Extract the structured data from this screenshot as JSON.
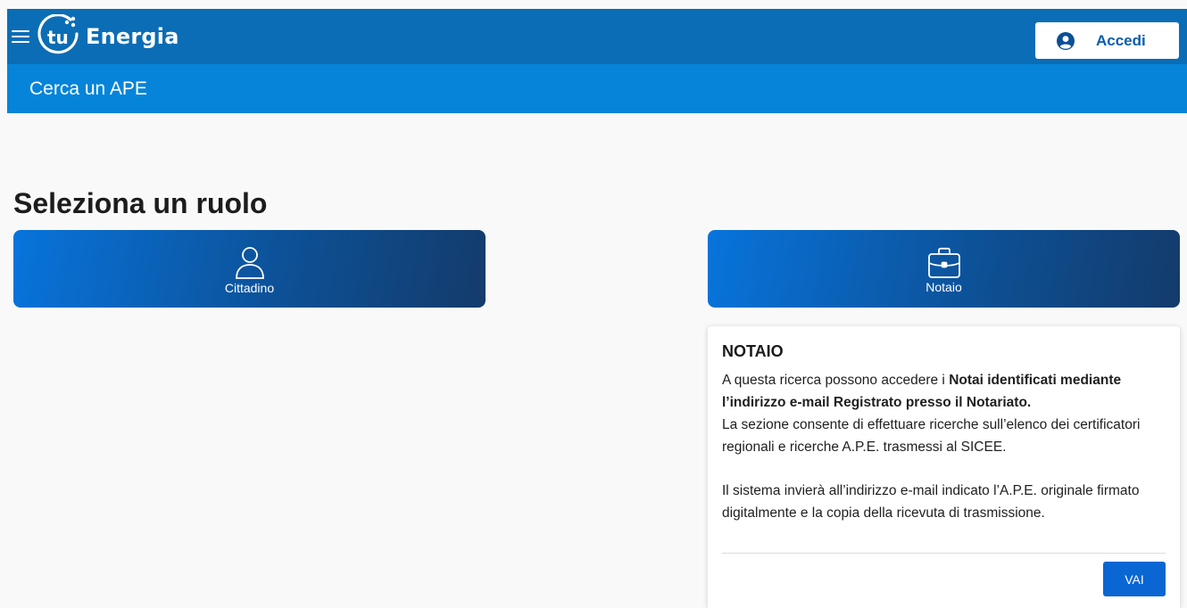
{
  "header": {
    "logo_mark": "tu",
    "logo_text": "Energia",
    "login_label": "Accedi"
  },
  "subheader": {
    "title": "Cerca un APE"
  },
  "main": {
    "title": "Seleziona un ruolo",
    "roles": [
      {
        "label": "Cittadino",
        "icon": "user-icon"
      },
      {
        "label": "Notaio",
        "icon": "briefcase-icon"
      }
    ]
  },
  "panel": {
    "title": "NOTAIO",
    "p1_pre": "A questa ricerca possono accedere i ",
    "p1_bold": "Notai identificati mediante l’indirizzo e-mail Registrato presso il Notariato.",
    "p1_post": "La sezione consente di effettuare ricerche sull’elenco dei certificatori regionali e ricerche A.P.E. trasmessi al SICEE.",
    "p2": "Il sistema invierà all’indirizzo e-mail indicato l’A.P.E. originale firmato digitalmente e la copia della ricevuta di trasmissione.",
    "button": "VAI"
  },
  "colors": {
    "topbar": "#0b6db5",
    "subbar": "#0584d9",
    "button": "#0966d2"
  }
}
